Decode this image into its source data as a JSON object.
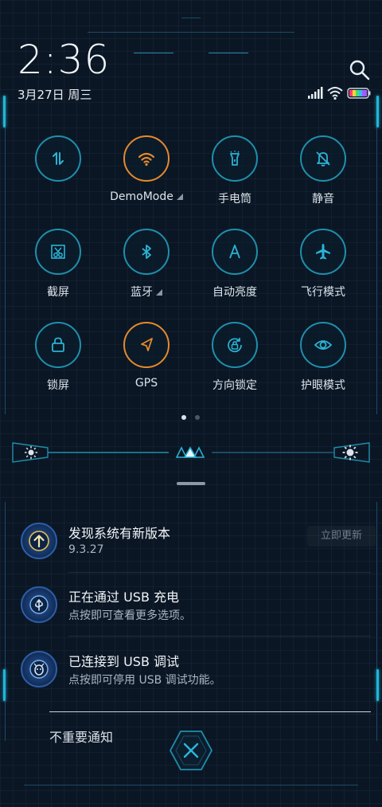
{
  "status": {
    "time": "2:36",
    "date": "3月27日 周三",
    "icons": [
      "signal-icon",
      "wifi-icon",
      "battery-icon"
    ]
  },
  "quick_settings": {
    "tiles": [
      {
        "id": "data",
        "label": "",
        "icon": "mobile-data-icon",
        "active": false
      },
      {
        "id": "wifi",
        "label": "DemoMode",
        "icon": "wifi-icon",
        "active": true,
        "has_menu": true
      },
      {
        "id": "flashlight",
        "label": "手电筒",
        "icon": "flashlight-icon",
        "active": false
      },
      {
        "id": "mute",
        "label": "静音",
        "icon": "bell-off-icon",
        "active": false
      },
      {
        "id": "screenshot",
        "label": "截屏",
        "icon": "scissors-icon",
        "active": false
      },
      {
        "id": "bluetooth",
        "label": "蓝牙",
        "icon": "bluetooth-icon",
        "active": false,
        "has_menu": true
      },
      {
        "id": "brightness_auto",
        "label": "自动亮度",
        "icon": "auto-brightness-icon",
        "active": false
      },
      {
        "id": "airplane",
        "label": "飞行模式",
        "icon": "airplane-icon",
        "active": false
      },
      {
        "id": "lock",
        "label": "锁屏",
        "icon": "lock-icon",
        "active": false
      },
      {
        "id": "gps",
        "label": "GPS",
        "icon": "location-arrow-icon",
        "active": true
      },
      {
        "id": "rotation",
        "label": "方向锁定",
        "icon": "rotation-lock-icon",
        "active": false
      },
      {
        "id": "eye",
        "label": "护眼模式",
        "icon": "eye-icon",
        "active": false
      }
    ],
    "page_indicator": {
      "pages": 2,
      "current": 1
    }
  },
  "brightness": {
    "level": 0.5
  },
  "notifications": [
    {
      "title": "发现系统有新版本",
      "subtitle": "9.3.27",
      "action": "立即更新",
      "icon": "update-arrow-icon"
    },
    {
      "title": "正在通过 USB 充电",
      "subtitle": "点按即可查看更多选项。",
      "icon": "usb-icon"
    },
    {
      "title": "已连接到 USB 调试",
      "subtitle": "点按即可停用 USB 调试功能。",
      "icon": "bug-icon"
    }
  ],
  "footer": {
    "unimportant_label": "不重要通知"
  },
  "colors": {
    "accent_cyan": "#1f8fab",
    "accent_orange": "#e58a2c",
    "background": "#0b1624"
  }
}
